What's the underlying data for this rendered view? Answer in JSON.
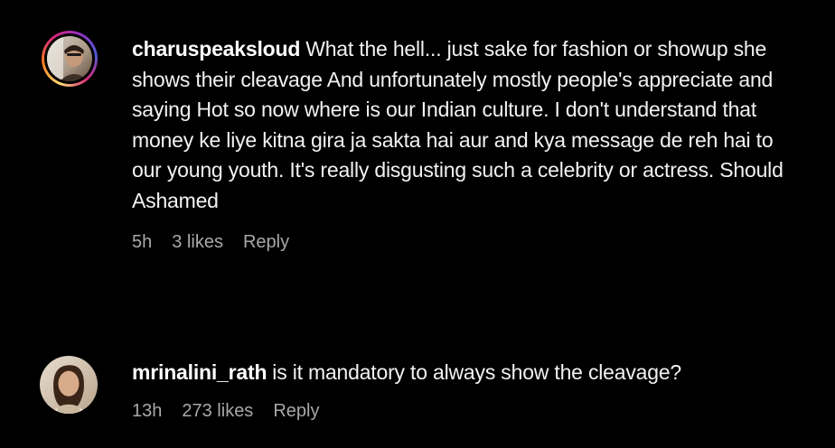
{
  "comments": [
    {
      "username": "charuspeaksloud",
      "text": "What the hell... just sake for fashion or showup she shows their cleavage And unfortunately mostly people's appreciate and saying Hot so now where is our Indian culture. I don't understand that money ke liye kitna gira ja sakta hai aur and kya message de reh hai to our young youth. It's really disgusting such a celebrity or actress. Should Ashamed",
      "time": "5h",
      "likes": "3 likes",
      "reply_label": "Reply",
      "has_story_ring": true
    },
    {
      "username": "mrinalini_rath",
      "text": "is it mandatory to always show the cleavage?",
      "time": "13h",
      "likes": "273 likes",
      "reply_label": "Reply",
      "has_story_ring": false
    }
  ],
  "colors": {
    "background": "#000000",
    "text": "#f2f2f2",
    "meta": "#a8a8a8",
    "ring_start": "#feda75",
    "ring_end": "#d62976"
  }
}
